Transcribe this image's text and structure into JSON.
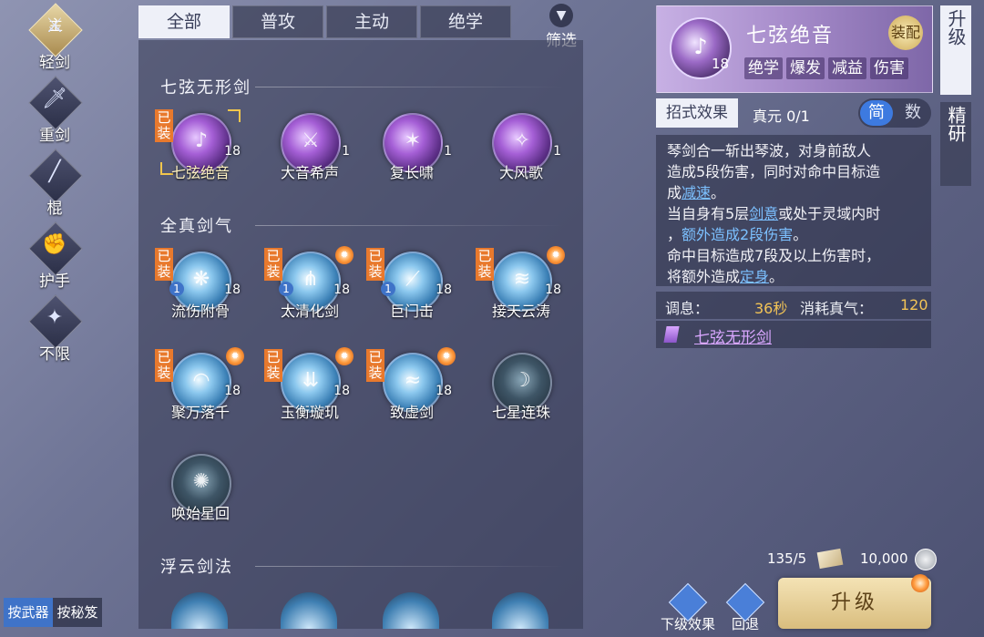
{
  "nav": {
    "main_mark": "主",
    "items": [
      {
        "label": "轻剑",
        "glyph": "⚔"
      },
      {
        "label": "重剑",
        "glyph": "🗡"
      },
      {
        "label": "棍",
        "glyph": "╱"
      },
      {
        "label": "护手",
        "glyph": "✊"
      },
      {
        "label": "不限",
        "glyph": "✦"
      }
    ]
  },
  "tabs": [
    "全部",
    "普攻",
    "主动",
    "绝学"
  ],
  "filter_label": "筛选",
  "sections": [
    {
      "title": "七弦无形剑",
      "skills": [
        {
          "name": "七弦绝音",
          "level": "18",
          "equipped": "已装"
        },
        {
          "name": "大音希声",
          "level": "1"
        },
        {
          "name": "复长啸",
          "level": "1"
        },
        {
          "name": "大风歌",
          "level": "1"
        }
      ]
    },
    {
      "title": "全真剑气",
      "skills": [
        {
          "name": "流伤附骨",
          "level": "18",
          "level_left": "1",
          "equipped": "已装"
        },
        {
          "name": "太清化剑",
          "level": "18",
          "level_left": "1",
          "equipped": "已装"
        },
        {
          "name": "巨门击",
          "level": "18",
          "level_left": "1",
          "equipped": "已装"
        },
        {
          "name": "接天云涛",
          "level": "18",
          "equipped": "已装"
        },
        {
          "name": "聚万落千",
          "level": "18",
          "equipped": "已装"
        },
        {
          "name": "玉衡璇玑",
          "level": "18",
          "equipped": "已装"
        },
        {
          "name": "致虚剑",
          "level": "18",
          "equipped": "已装"
        },
        {
          "name": "七星连珠",
          "level": ""
        },
        {
          "name": "唤始星回",
          "level": ""
        }
      ]
    },
    {
      "title": "浮云剑法",
      "skills": []
    }
  ],
  "detail": {
    "title": "七弦绝音",
    "level": "18",
    "equip_badge": "装配",
    "tags": [
      "绝学",
      "爆发",
      "减益",
      "伤害"
    ],
    "tab_effect": "招式效果",
    "zhenyuan": "真元 0/1",
    "toggle_simple": "简",
    "toggle_number": "数",
    "desc_lines": [
      {
        "parts": [
          {
            "t": "琴剑合一斩出琴波，对身前敌人"
          }
        ]
      },
      {
        "parts": [
          {
            "t": "造成5段伤害，同时对命中目标造"
          }
        ]
      },
      {
        "parts": [
          {
            "t": "成"
          },
          {
            "t": "减速",
            "k": "hl"
          },
          {
            "t": "。"
          }
        ]
      },
      {
        "parts": [
          {
            "t": "当自身有5层"
          },
          {
            "t": "剑意",
            "k": "hl"
          },
          {
            "t": "或处于灵域内时"
          }
        ]
      },
      {
        "parts": [
          {
            "t": "，"
          },
          {
            "t": "额外造成2段伤害",
            "k": "hlg"
          },
          {
            "t": "。"
          }
        ]
      },
      {
        "parts": [
          {
            "t": "命中目标造成7段及以上伤害时，"
          }
        ]
      },
      {
        "parts": [
          {
            "t": "将额外造成"
          },
          {
            "t": "定身",
            "k": "hl"
          },
          {
            "t": "。"
          }
        ]
      }
    ],
    "cooldown_label": "调息：",
    "cooldown_value": "36秒",
    "cost_label": "消耗真气：",
    "cost_value": "120",
    "set_name": "七弦无形剑"
  },
  "side_buttons": {
    "upgrade": "升级",
    "refine": "精研"
  },
  "resources": {
    "scroll": "135/5",
    "coins": "10,000"
  },
  "bottom": {
    "next_effect": "下级效果",
    "back": "回退",
    "upgrade": "升级",
    "tab_weapon": "按武器",
    "tab_secret": "按秘笈"
  }
}
